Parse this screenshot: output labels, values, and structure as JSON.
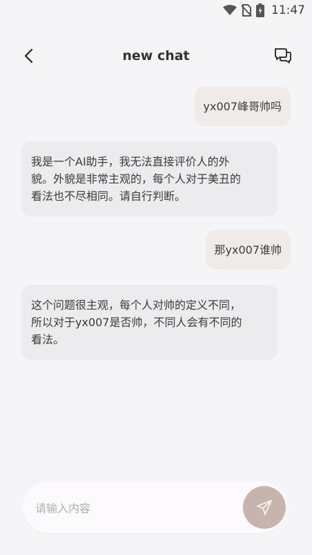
{
  "status_bar": {
    "time": "11:47"
  },
  "header": {
    "title": "new chat"
  },
  "messages": [
    {
      "role": "user",
      "text": "yx007峰哥帅吗"
    },
    {
      "role": "bot",
      "lines": [
        "我是一个AI助手，我无法直接评价人的外",
        "貌。外貌是非常主观的，每个人对于美丑的",
        "看法也不尽相同。请自行判断。"
      ]
    },
    {
      "role": "user",
      "text": "那yx007谁帅"
    },
    {
      "role": "bot",
      "lines": [
        "这个问题很主观，每个人对帅的定义不同，",
        "所以对于yx007是否帅，不同人会有不同的",
        "看法。"
      ]
    }
  ],
  "composer": {
    "placeholder": "请输入内容"
  },
  "colors": {
    "user_bubble": "#f0ebe8",
    "bot_bubble": "#ececef",
    "send_button": "#c7b4ad"
  }
}
